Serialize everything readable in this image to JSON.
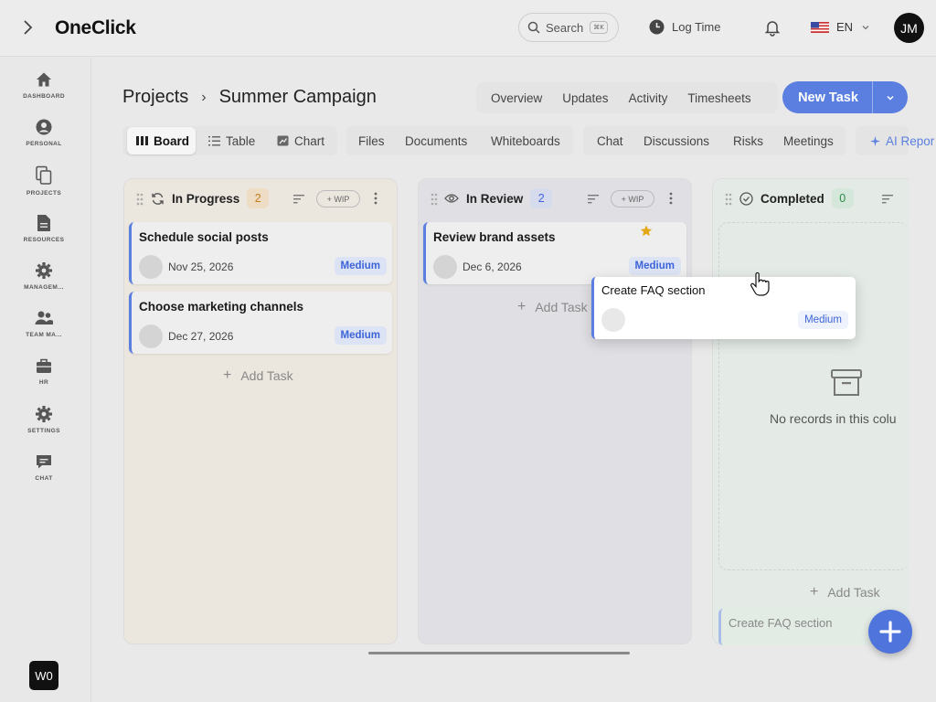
{
  "app": {
    "title": "OneClick"
  },
  "header": {
    "search_label": "Search",
    "search_shortcut": "⌘K",
    "log_time": "Log Time",
    "language": "EN",
    "avatar_initials": "JM"
  },
  "sidebar": {
    "items": [
      {
        "label": "DASHBOARD",
        "icon": "home-icon"
      },
      {
        "label": "PERSONAL",
        "icon": "user-icon"
      },
      {
        "label": "PROJECTS",
        "icon": "copy-icon"
      },
      {
        "label": "RESOURCES",
        "icon": "document-icon"
      },
      {
        "label": "MANAGEM...",
        "icon": "gear-icon"
      },
      {
        "label": "TEAM MA...",
        "icon": "team-icon"
      },
      {
        "label": "HR",
        "icon": "briefcase-icon"
      },
      {
        "label": "SETTINGS",
        "icon": "gear-icon"
      },
      {
        "label": "CHAT",
        "icon": "chat-icon"
      }
    ],
    "workspace": "W0"
  },
  "breadcrumb": {
    "root": "Projects",
    "current": "Summer Campaign"
  },
  "page_tabs": [
    "Overview",
    "Updates",
    "Activity",
    "Timesheets"
  ],
  "new_task_label": "New Task",
  "views": {
    "board": "Board",
    "table": "Table",
    "chart": "Chart",
    "files": "Files",
    "documents": "Documents",
    "whiteboards": "Whiteboards",
    "chat": "Chat",
    "discussions": "Discussions",
    "risks": "Risks",
    "meetings": "Meetings",
    "ai_reports": "AI Repor"
  },
  "columns": [
    {
      "title": "In Progress",
      "count": "2",
      "wip": "+ WIP",
      "cards": [
        {
          "title": "Schedule social posts",
          "date": "Nov 25, 2026",
          "priority": "Medium"
        },
        {
          "title": "Choose marketing channels",
          "date": "Dec 27, 2026",
          "priority": "Medium"
        }
      ],
      "add_label": "Add Task"
    },
    {
      "title": "In Review",
      "count": "2",
      "wip": "+ WIP",
      "cards": [
        {
          "title": "Review brand assets",
          "date": "Dec 6, 2026",
          "priority": "Medium"
        }
      ],
      "add_label": "Add Task"
    },
    {
      "title": "Completed",
      "count": "0",
      "empty_text": "No records in this colu",
      "add_label": "Add Task",
      "drop_placeholder": "Create FAQ section"
    }
  ],
  "dragging_card": {
    "title": "Create FAQ section",
    "priority": "Medium"
  },
  "colors": {
    "accent": "#5b7fe0",
    "in_progress_bg": "#ebe6de",
    "in_review_bg": "#e0e0e4",
    "completed_bg": "#e4eae6",
    "star": "#e3a817"
  }
}
